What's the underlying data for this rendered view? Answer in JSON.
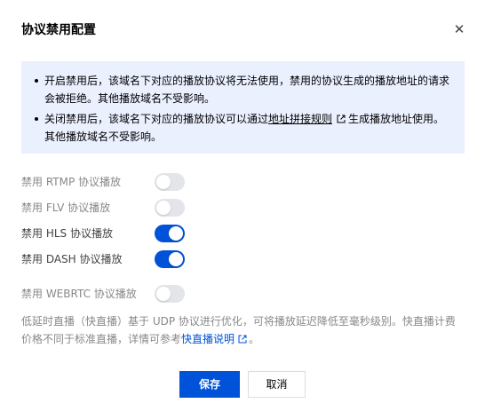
{
  "dialog": {
    "title": "协议禁用配置",
    "close_glyph": "✕"
  },
  "notice": {
    "item1": "开启禁用后，该域名下对应的播放协议将无法使用，禁用的协议生成的播放地址的请求会被拒绝。其他播放域名不受影响。",
    "item2_prefix": "关闭禁用后，该域名下对应的播放协议可以通过",
    "item2_link": "地址拼接规则",
    "item2_suffix": "生成播放地址使用。其他播放域名不受影响。"
  },
  "protocols": [
    {
      "label": "禁用 RTMP 协议播放",
      "enabled": false
    },
    {
      "label": "禁用 FLV 协议播放",
      "enabled": false
    },
    {
      "label": "禁用 HLS 协议播放",
      "enabled": true
    },
    {
      "label": "禁用 DASH 协议播放",
      "enabled": true
    },
    {
      "label": "禁用 WEBRTC 协议播放",
      "enabled": false
    }
  ],
  "webrtc_desc": {
    "text": "低延时直播（快直播）基于 UDP 协议进行优化，可将播放延迟降低至毫秒级别。快直播计费价格不同于标准直播，详情可参考",
    "link": "快直播说明",
    "end": "。"
  },
  "buttons": {
    "save": "保存",
    "cancel": "取消"
  },
  "colors": {
    "accent": "#0052d9",
    "notice_bg": "#ebf0ff",
    "toggle_off": "#e3e5ea"
  },
  "icons": {
    "external_link": "external-link-icon",
    "close": "close-icon"
  }
}
